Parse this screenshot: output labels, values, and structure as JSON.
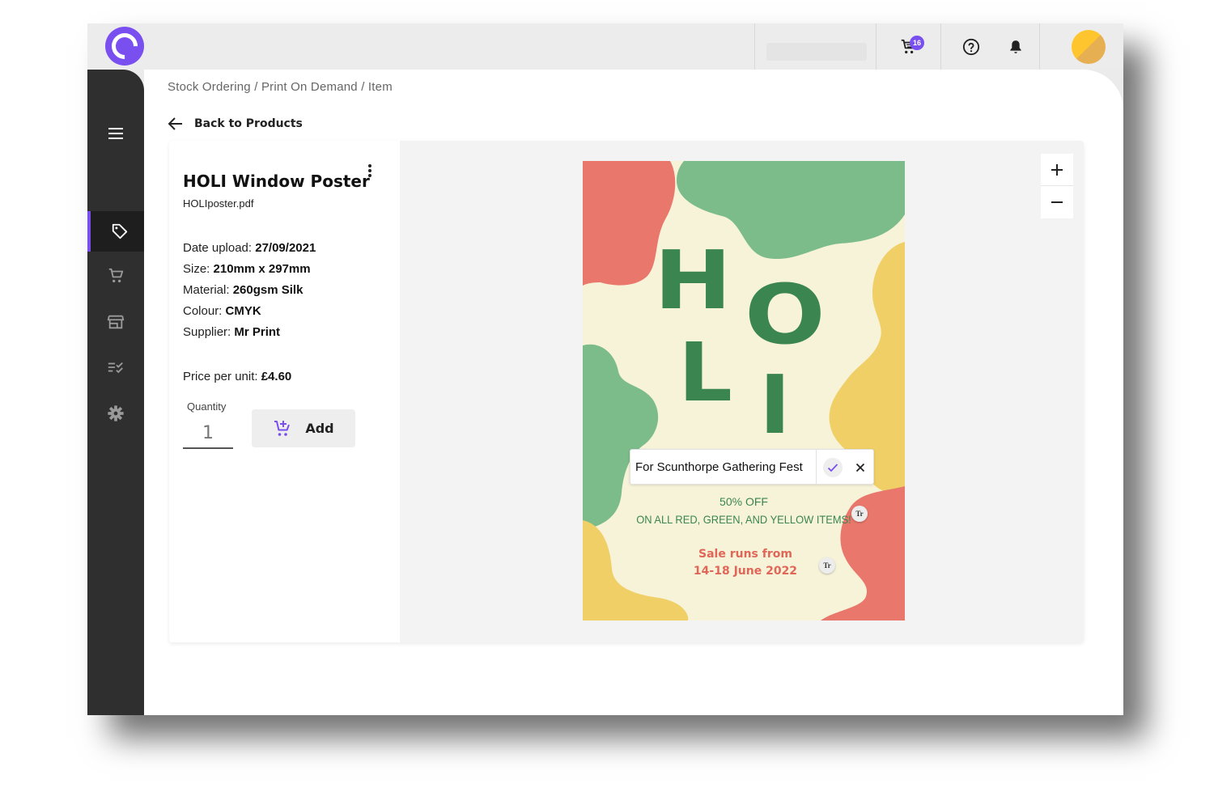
{
  "header": {
    "cart_count": "16",
    "icons": [
      "logo-c",
      "cart-icon",
      "help-icon",
      "bell-icon",
      "avatar"
    ]
  },
  "sidebar": {
    "items": [
      {
        "icon": "menu-icon"
      },
      {
        "icon": "tag-icon",
        "active": true
      },
      {
        "icon": "cart-icon"
      },
      {
        "icon": "store-icon"
      },
      {
        "icon": "checklist-icon"
      },
      {
        "icon": "gear-icon"
      }
    ]
  },
  "breadcrumb": "Stock Ordering / Print On Demand / Item",
  "back_label": "Back to Products",
  "product": {
    "title": "HOLI Window Poster",
    "file": "HOLIposter.pdf",
    "specs": {
      "date_label": "Date upload: ",
      "date_value": "27/09/2021",
      "size_label": "Size: ",
      "size_value": "210mm x 297mm",
      "material_label": "Material: ",
      "material_value": "260gsm Silk",
      "colour_label": "Colour: ",
      "colour_value": "CMYK",
      "supplier_label": "Supplier: ",
      "supplier_value": "Mr Print",
      "price_label": "Price per unit: ",
      "price_value": "£4.60"
    },
    "quantity_label": "Quantity",
    "quantity_placeholder": "1",
    "add_label": "Add"
  },
  "poster": {
    "letters": [
      "H",
      "O",
      "L",
      "I"
    ],
    "sale_line1": "50% OFF",
    "sale_line2": "ON ALL RED, GREEN, AND YELLOW ITEMS!",
    "runs_line1": "Sale runs from",
    "runs_line2": "14-18 June 2022",
    "badge_text": "Tr",
    "colors": {
      "background": "#f7f3d9",
      "red": "#e9776b",
      "green": "#7cbb8a",
      "yellow": "#f0cf66",
      "text_green": "#3a8550",
      "text_red": "#e06658"
    }
  },
  "text_editor": {
    "value": "For Scunthorpe Gathering Fest"
  },
  "colors": {
    "accent": "#7a4ff0",
    "sidebar": "#2f2f2f",
    "avatar": "#ffc52e"
  }
}
